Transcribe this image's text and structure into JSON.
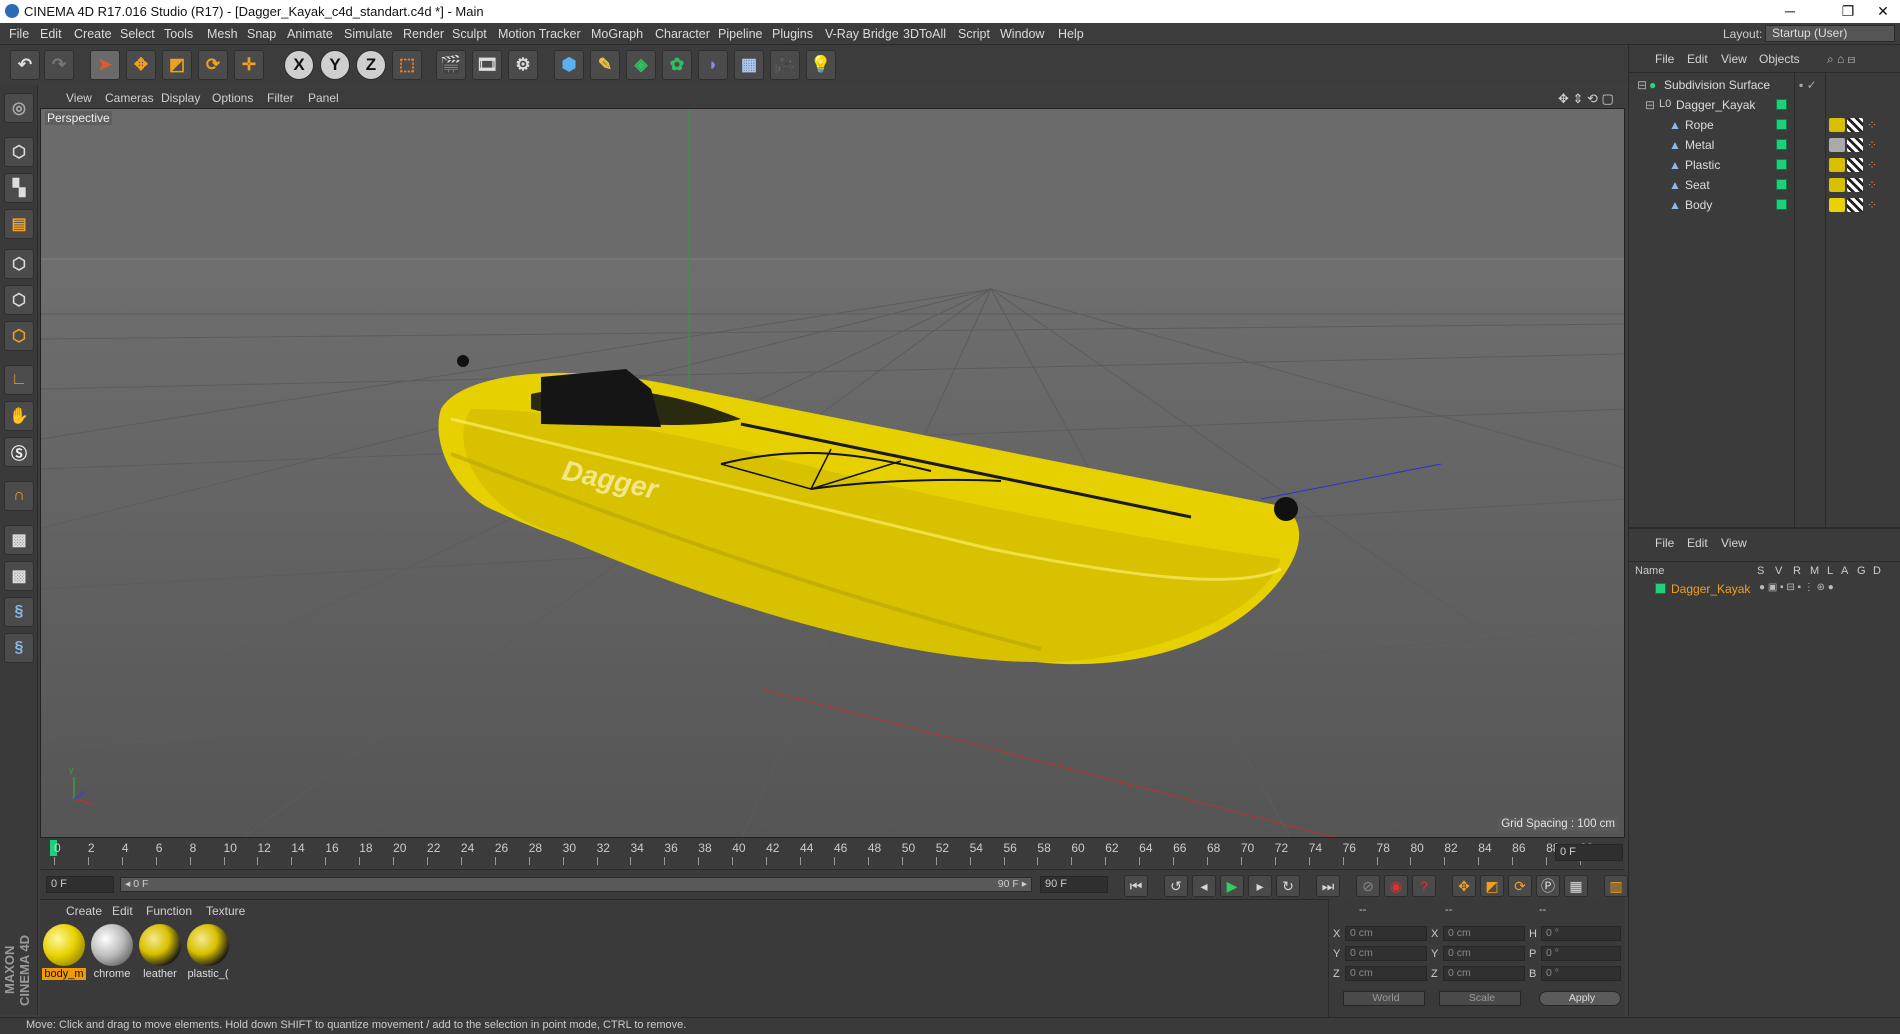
{
  "window": {
    "title": "CINEMA 4D R17.016 Studio (R17) - [Dagger_Kayak_c4d_standart.c4d *] - Main",
    "minimize": "─",
    "restore": "❐",
    "close": "✕"
  },
  "menu": [
    "File",
    "Edit",
    "Create",
    "Select",
    "Tools",
    "Mesh",
    "Snap",
    "Animate",
    "Simulate",
    "Render",
    "Sculpt",
    "Motion Tracker",
    "MoGraph",
    "Character",
    "Pipeline",
    "Plugins",
    "V-Ray Bridge",
    "3DToAll",
    "Script",
    "Window",
    "Help"
  ],
  "layout": {
    "label": "Layout:",
    "value": "Startup (User)"
  },
  "toolbar": {
    "axis_x": "X",
    "axis_y": "Y",
    "axis_z": "Z"
  },
  "viewport": {
    "menu": [
      "View",
      "Cameras",
      "Display",
      "Options",
      "Filter",
      "Panel"
    ],
    "label": "Perspective",
    "grid_spacing": "Grid Spacing : 100 cm",
    "kayak_brand": "Dagger"
  },
  "timeline": {
    "ticks": [
      "0",
      "2",
      "4",
      "6",
      "8",
      "10",
      "12",
      "14",
      "16",
      "18",
      "20",
      "22",
      "24",
      "26",
      "28",
      "30",
      "32",
      "34",
      "36",
      "38",
      "40",
      "42",
      "44",
      "46",
      "48",
      "50",
      "52",
      "54",
      "56",
      "58",
      "60",
      "62",
      "64",
      "66",
      "68",
      "70",
      "72",
      "74",
      "76",
      "78",
      "80",
      "82",
      "84",
      "86",
      "88",
      "90"
    ],
    "current_frame": "0 F",
    "start_field": "0 F",
    "range_start": "◂ 0 F",
    "range_end": "90 F ▸",
    "end_field": "90 F"
  },
  "materials": {
    "menu": [
      "Create",
      "Edit",
      "Function",
      "Texture"
    ],
    "items": [
      {
        "name": "body_m",
        "color": "#e8d200"
      },
      {
        "name": "chrome",
        "color": "#bcbcbc"
      },
      {
        "name": "leather",
        "color": "#d8c000"
      },
      {
        "name": "plastic_(",
        "color": "#d8c000"
      }
    ]
  },
  "coords": {
    "header": [
      "--",
      "--",
      "--"
    ],
    "rows": [
      {
        "a": "X",
        "av": "0 cm",
        "b": "X",
        "bv": "0 cm",
        "c": "H",
        "cv": "0 °"
      },
      {
        "a": "Y",
        "av": "0 cm",
        "b": "Y",
        "bv": "0 cm",
        "c": "P",
        "cv": "0 °"
      },
      {
        "a": "Z",
        "av": "0 cm",
        "b": "Z",
        "bv": "0 cm",
        "c": "B",
        "cv": "0 °"
      }
    ],
    "space": "World",
    "mode": "Scale",
    "apply": "Apply"
  },
  "objects": {
    "menu": [
      "File",
      "Edit",
      "View",
      "Objects"
    ],
    "tree": [
      {
        "name": "Subdivision Surface",
        "level": 0
      },
      {
        "name": "Dagger_Kayak",
        "level": 1
      },
      {
        "name": "Rope",
        "level": 2
      },
      {
        "name": "Metal",
        "level": 2
      },
      {
        "name": "Plastic",
        "level": 2
      },
      {
        "name": "Seat",
        "level": 2
      },
      {
        "name": "Body",
        "level": 2
      }
    ]
  },
  "attributes": {
    "menu": [
      "File",
      "Edit",
      "View"
    ],
    "columns": [
      "Name",
      "S",
      "V",
      "R",
      "M",
      "L",
      "A",
      "G",
      "D"
    ],
    "layer": "Dagger_Kayak"
  },
  "status": "Move: Click and drag to move elements. Hold down SHIFT to quantize movement / add to the selection in point mode, CTRL to remove.",
  "brand": "MAXON CINEMA 4D"
}
